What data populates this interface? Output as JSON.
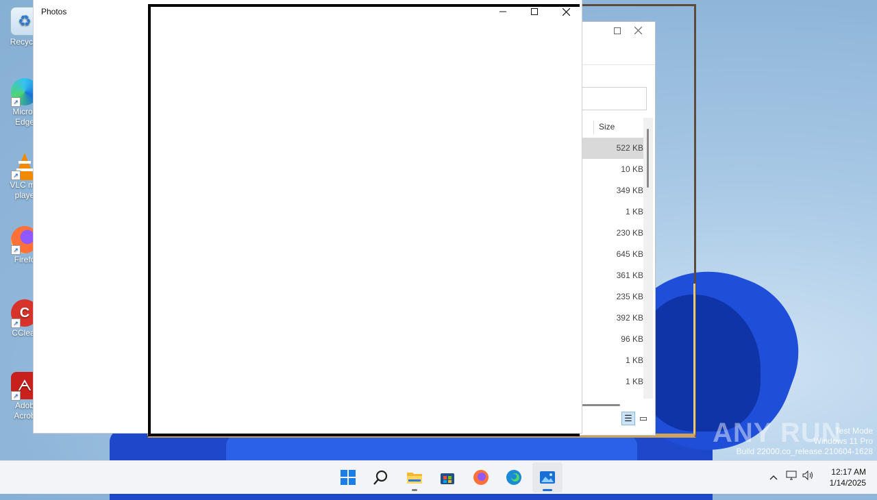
{
  "desktop": {
    "icons": [
      {
        "label": "Recycle",
        "icon": "recycle-bin-icon"
      },
      {
        "label": "Micros\nEdge",
        "icon": "edge-icon"
      },
      {
        "label": "VLC me\nplaye",
        "icon": "vlc-icon"
      },
      {
        "label": "Firefo",
        "icon": "firefox-icon"
      },
      {
        "label": "CClear",
        "icon": "ccleaner-icon"
      },
      {
        "label": "Adob\nAcrob",
        "icon": "acrobat-icon"
      }
    ]
  },
  "photos_window": {
    "title": "Photos",
    "minimize_icon": "minimize-icon",
    "maximize_icon": "maximize-icon",
    "close_icon": "close-icon"
  },
  "explorer_window": {
    "column_header": "Size",
    "sizes": [
      "522 KB",
      "10 KB",
      "349 KB",
      "1 KB",
      "230 KB",
      "645 KB",
      "361 KB",
      "235 KB",
      "392 KB",
      "96 KB",
      "1 KB",
      "1 KB"
    ],
    "selected_index": 0
  },
  "watermark": {
    "brand": "ANY RUN",
    "line1": "Test Mode",
    "line2": "Windows 11 Pro",
    "line3": "Build 22000.co_release.210604-1628"
  },
  "taskbar": {
    "apps": [
      {
        "name": "start",
        "icon": "windows-start-icon"
      },
      {
        "name": "search",
        "icon": "search-icon"
      },
      {
        "name": "file-explorer",
        "icon": "folder-icon"
      },
      {
        "name": "store",
        "icon": "store-icon"
      },
      {
        "name": "firefox",
        "icon": "firefox-icon"
      },
      {
        "name": "edge",
        "icon": "edge-icon"
      },
      {
        "name": "photos",
        "icon": "photos-icon"
      }
    ],
    "time": "12:17 AM",
    "date": "1/14/2025"
  },
  "colors": {
    "accent": "#1a6fd6",
    "frame_dark": "#5b4b3c",
    "frame_gold": "#cfa45e"
  }
}
